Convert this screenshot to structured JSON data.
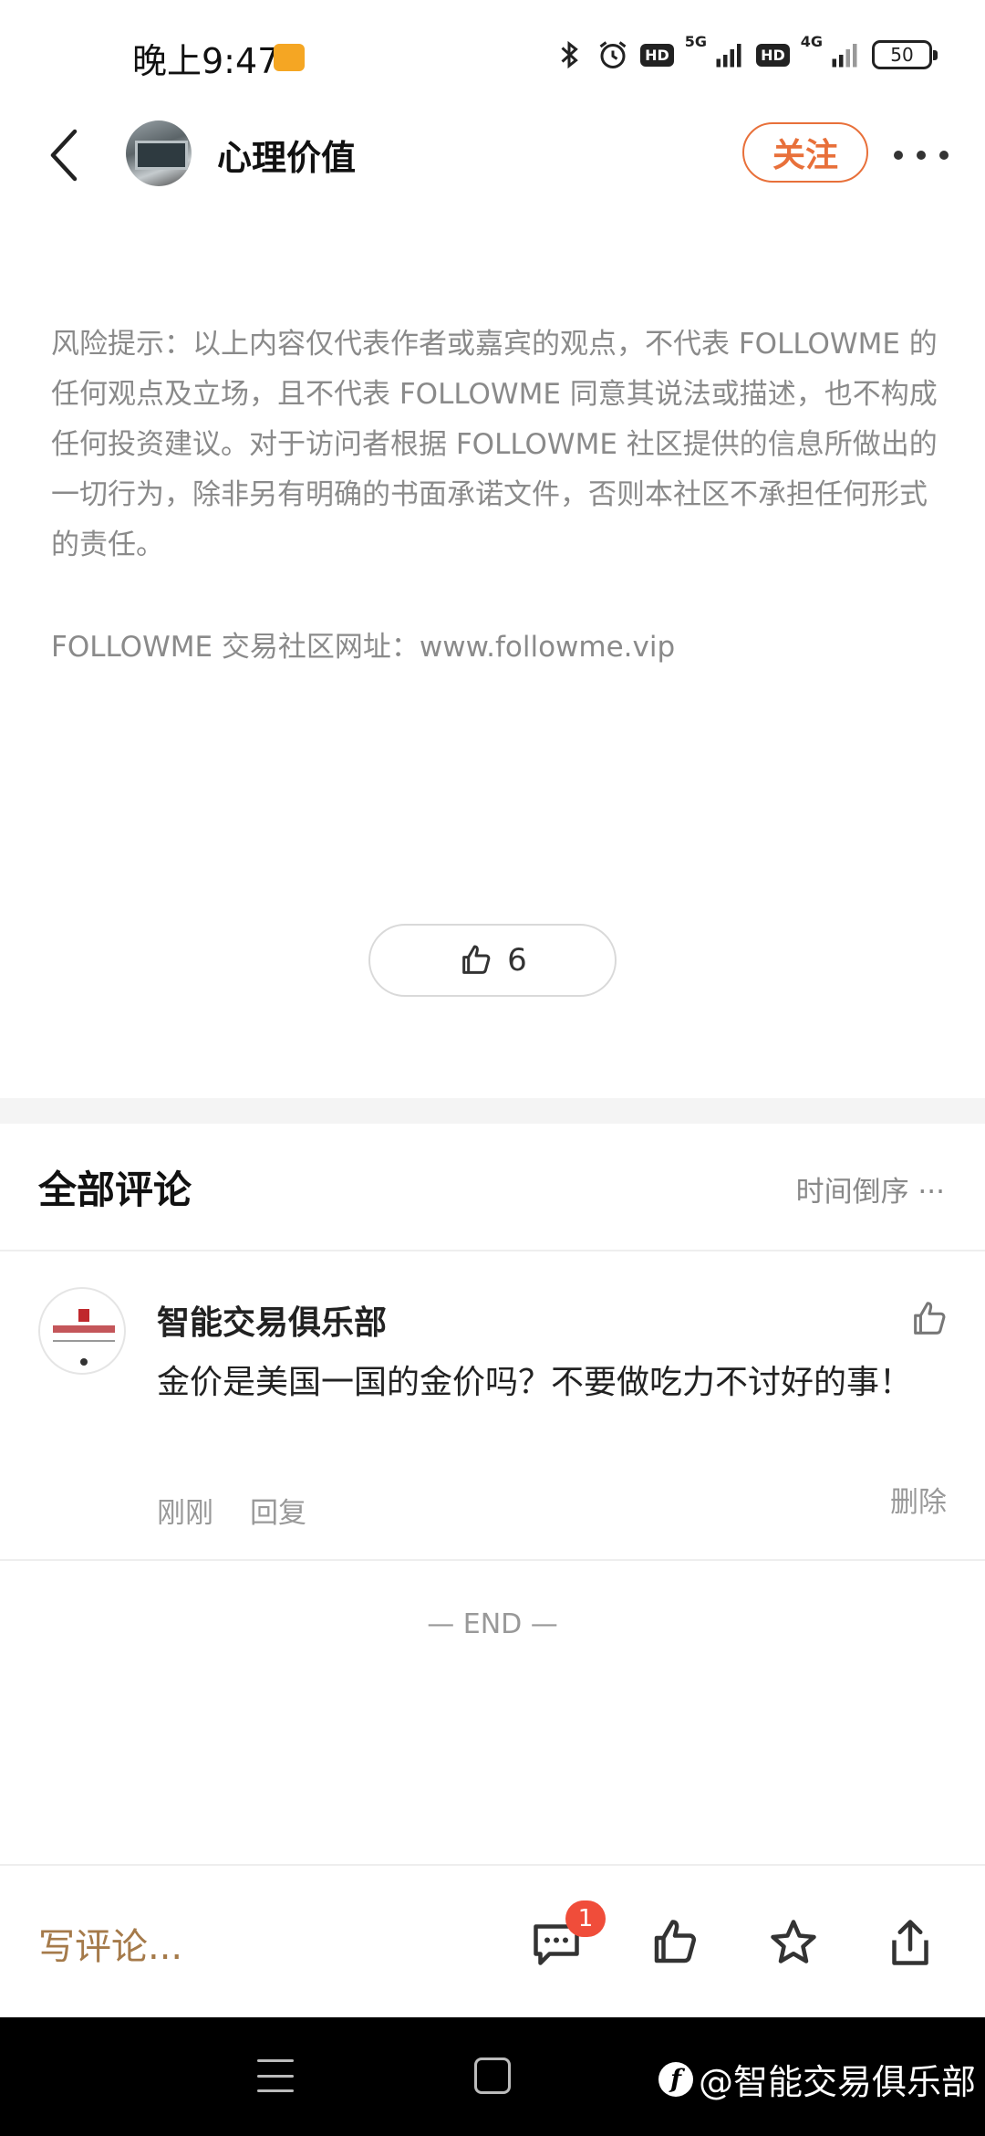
{
  "status_bar": {
    "time": "晚上9:47",
    "hd1": "HD",
    "net1": "5G",
    "hd2": "HD",
    "net2": "4G",
    "battery": "50"
  },
  "header": {
    "author": "心理价值",
    "follow_label": "关注"
  },
  "article": {
    "disclaimer": "风险提示：以上内容仅代表作者或嘉宾的观点，不代表 FOLLOWME 的任何观点及立场，且不代表 FOLLOWME 同意其说法或描述，也不构成任何投资建议。对于访问者根据 FOLLOWME 社区提供的信息所做出的一切行为，除非另有明确的书面承诺文件，否则本社区不承担任何形式的责任。",
    "site_line": "FOLLOWME 交易社区网址：www.followme.vip",
    "like_count": "6"
  },
  "comments": {
    "title": "全部评论",
    "sort_label": "时间倒序 ···",
    "items": [
      {
        "author": "智能交易俱乐部",
        "text": "金价是美国一国的金价吗？不要做吃力不讨好的事！",
        "time": "刚刚",
        "reply_label": "回复",
        "delete_label": "删除"
      }
    ],
    "end_label": "— END —"
  },
  "bottom_bar": {
    "write_placeholder": "写评论...",
    "comment_badge": "1"
  },
  "watermark": {
    "text": "@智能交易俱乐部"
  },
  "colors": {
    "accent": "#e8703a",
    "write_comment": "#a57a4a",
    "badge": "#f04d3a"
  }
}
